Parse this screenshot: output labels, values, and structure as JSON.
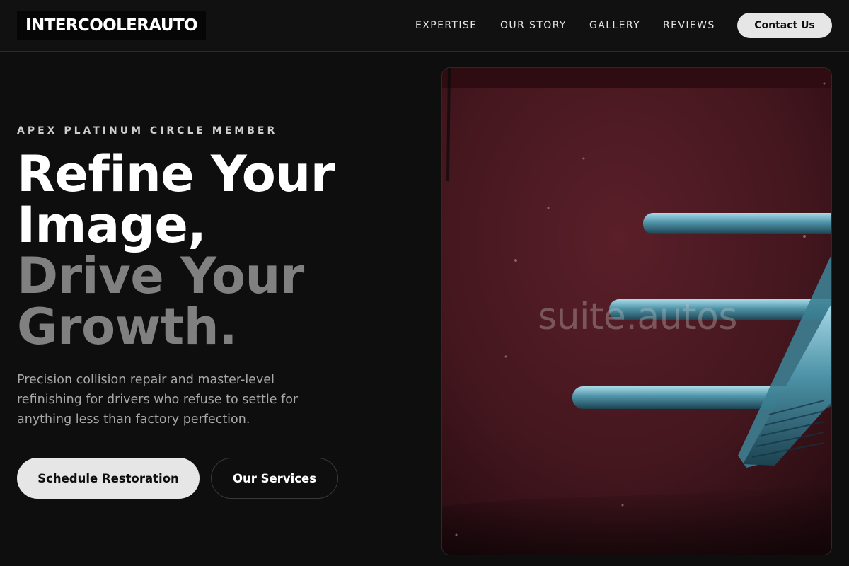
{
  "brand": {
    "logo_text": "INTERCOOLERAUTO"
  },
  "nav": {
    "links": [
      "EXPERTISE",
      "OUR STORY",
      "GALLERY",
      "REVIEWS"
    ],
    "contact_label": "Contact Us"
  },
  "hero": {
    "eyebrow": "APEX PLATINUM CIRCLE MEMBER",
    "headline_lines": [
      "Refine Your",
      "Image,",
      "Drive Your",
      "Growth."
    ],
    "lead": "Precision collision repair and master-level refinishing for drivers who refuse to settle for anything less than factory perfection.",
    "primary_cta": "Schedule Restoration",
    "secondary_cta": "Our Services",
    "image_watermark": "suite.autos"
  },
  "colors": {
    "background": "#0e0e0e",
    "accent_button": "#e6e6e6",
    "headline_dim": "#808080",
    "car_paint": "#4a1a22",
    "chrome": "#6fb0c4"
  }
}
